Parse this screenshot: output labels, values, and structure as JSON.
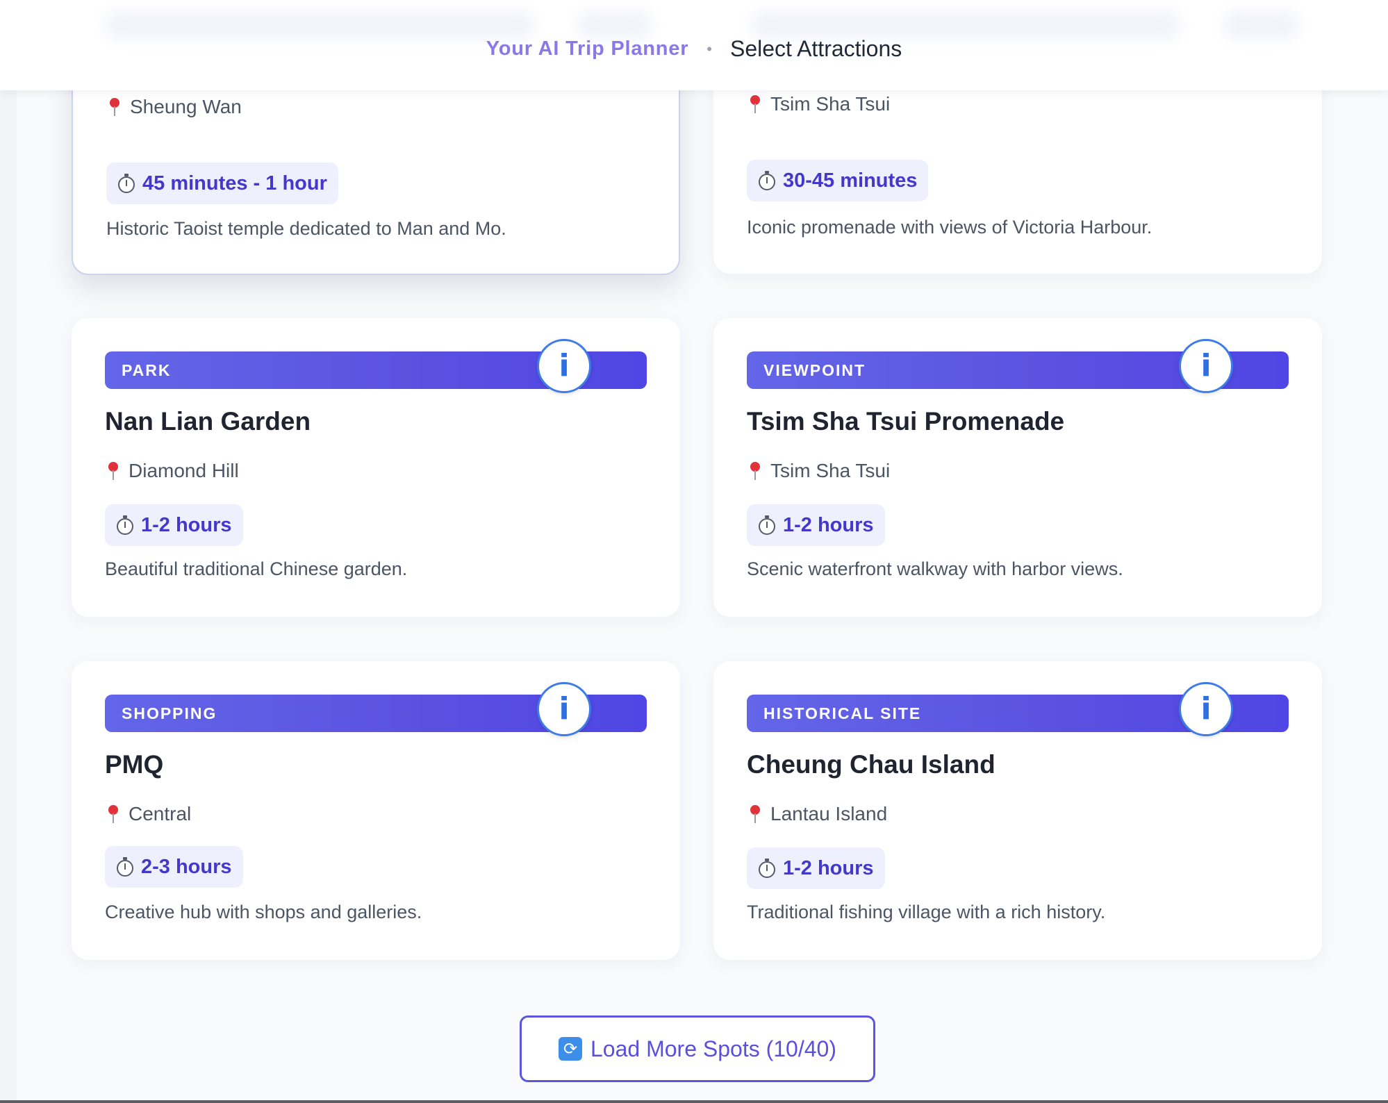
{
  "header": {
    "app_name": "Your AI Trip Planner",
    "separator": "•",
    "page_title": "Select Attractions"
  },
  "cards": [
    {
      "location": "Sheung Wan",
      "duration": "45 minutes - 1 hour",
      "description": "Historic Taoist temple dedicated to Man and Mo.",
      "selected": true
    },
    {
      "location": "Tsim Sha Tsui",
      "duration": "30-45 minutes",
      "description": "Iconic promenade with views of Victoria Harbour."
    },
    {
      "category": "PARK",
      "title": "Nan Lian Garden",
      "location": "Diamond Hill",
      "duration": "1-2 hours",
      "description": "Beautiful traditional Chinese garden."
    },
    {
      "category": "VIEWPOINT",
      "title": "Tsim Sha Tsui Promenade",
      "location": "Tsim Sha Tsui",
      "duration": "1-2 hours",
      "description": "Scenic waterfront walkway with harbor views."
    },
    {
      "category": "SHOPPING",
      "title": "PMQ",
      "location": "Central",
      "duration": "2-3 hours",
      "description": "Creative hub with shops and galleries."
    },
    {
      "category": "HISTORICAL SITE",
      "title": "Cheung Chau Island",
      "location": "Lantau Island",
      "duration": "1-2 hours",
      "description": "Traditional fishing village with a rich history."
    }
  ],
  "icons": {
    "info": "info-icon",
    "pin": "location-pin-icon",
    "timer": "stopwatch-icon",
    "refresh": "refresh-icon"
  },
  "info_glyph": "i",
  "refresh_glyph": "⟳",
  "load_more": {
    "label": "Load More Spots (10/40)"
  },
  "colors": {
    "accent": "#4f46e5",
    "category_gradient_start": "#6366e8",
    "info_ring": "#3f7be8",
    "duration_text": "#4338ca",
    "app_name": "#8a78e6"
  }
}
